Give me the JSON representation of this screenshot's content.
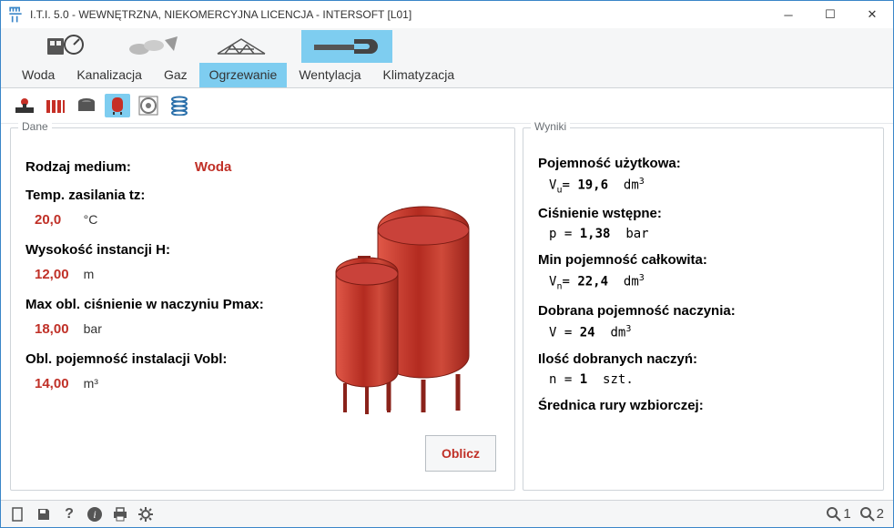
{
  "title": "I.T.I. 5.0 - WEWNĘTRZNA, NIEKOMERCYJNA LICENCJA - INTERSOFT [L01]",
  "tabs": [
    "Woda",
    "Kanalizacja",
    "Gaz",
    "Ogrzewanie",
    "Wentylacja",
    "Klimatyzacja"
  ],
  "active_tab_index": 3,
  "panels": {
    "left": "Dane",
    "right": "Wyniki"
  },
  "inputs": {
    "medium_label": "Rodzaj medium:",
    "medium_value": "Woda",
    "tz_label": "Temp. zasilania tz:",
    "tz_value": "20,0",
    "tz_unit": "°C",
    "h_label": "Wysokość instancji H:",
    "h_value": "12,00",
    "h_unit": "m",
    "pmax_label": "Max obl. ciśnienie w naczyniu Pmax:",
    "pmax_value": "18,00",
    "pmax_unit": "bar",
    "vobl_label": "Obl. pojemność instalacji Vobl:",
    "vobl_value": "14,00",
    "vobl_unit": "m³"
  },
  "button_calc": "Oblicz",
  "results": {
    "vu_label": "Pojemność użytkowa:",
    "vu_sym": "Vᵤ=",
    "vu_value": "19,6",
    "vu_unit": "dm³",
    "p_label": "Ciśnienie wstępne:",
    "p_sym": "p =",
    "p_value": "1,38",
    "p_unit": "bar",
    "vn_label": "Min pojemność całkowita:",
    "vn_sym": "Vₙ=",
    "vn_value": "22,4",
    "vn_unit": "dm³",
    "v_label": "Dobrana pojemność naczynia:",
    "v_sym": "V =",
    "v_value": "24",
    "v_unit": "dm³",
    "n_label": "Ilość dobranych naczyń:",
    "n_sym": "n =",
    "n_value": "1",
    "n_unit": "szt.",
    "d_label": "Średnica rury wzbiorczej:"
  },
  "status_right": {
    "one": "1",
    "two": "2"
  }
}
